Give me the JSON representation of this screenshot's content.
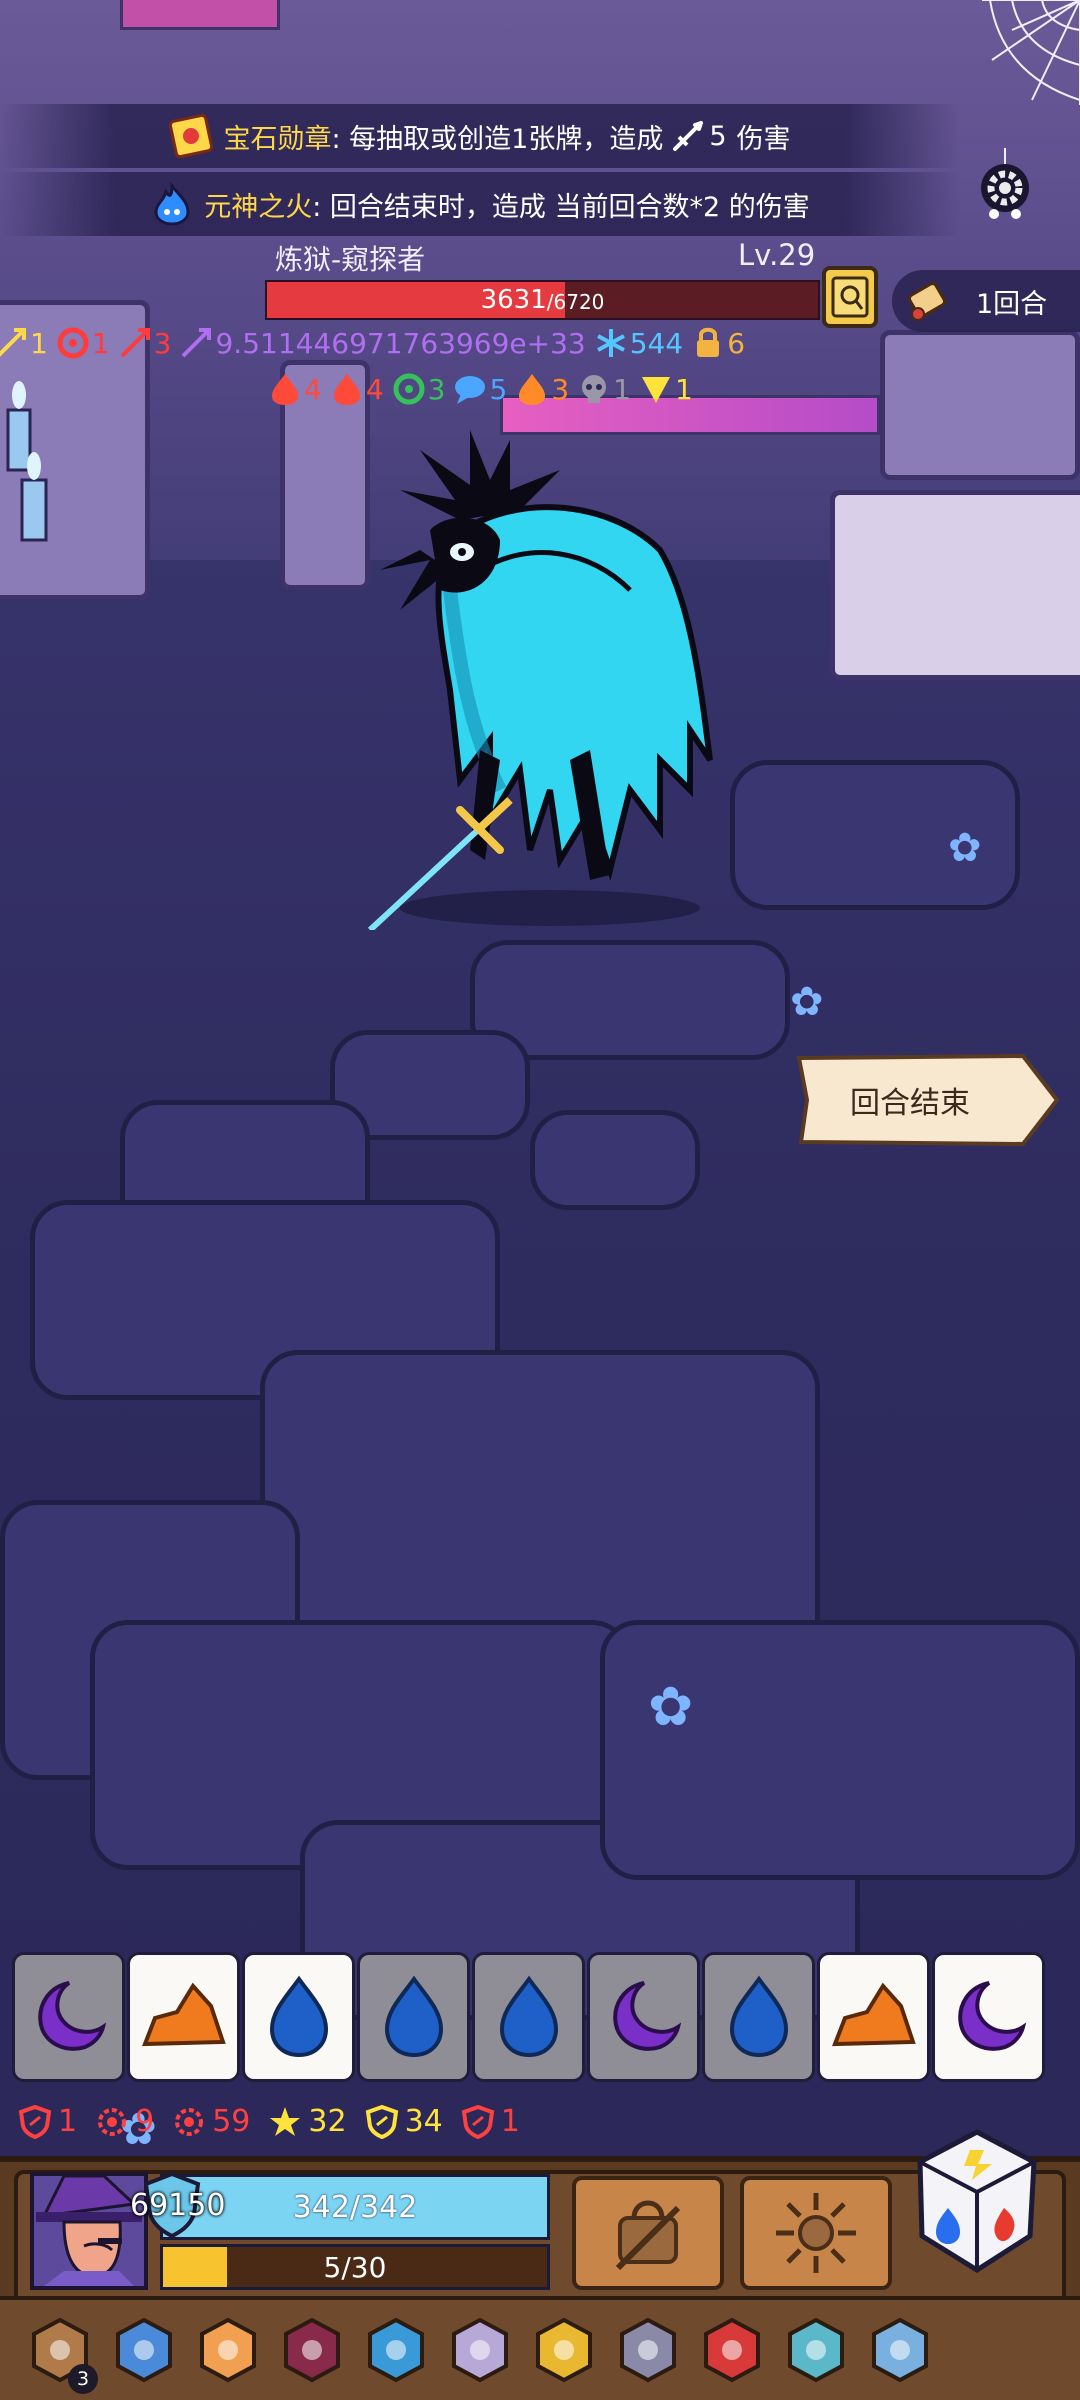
{
  "banners": {
    "gem_medal": {
      "name": "宝石勋章",
      "desc_prefix": ": 每抽取或创造1张牌，造成",
      "damage": "5",
      "desc_suffix": "伤害",
      "icon": "gem-medal-icon"
    },
    "soul_fire": {
      "name": "元神之火",
      "desc": ": 回合结束时，造成 当前回合数*2 的伤害",
      "icon": "blue-fire-icon"
    }
  },
  "enemy": {
    "name": "炼狱-窥探者",
    "level": "Lv.29",
    "hp_current": "3631",
    "hp_max": "/6720",
    "hp_fraction": 0.54
  },
  "round": {
    "label": "1回合"
  },
  "enemy_status": {
    "row1": [
      {
        "icon": "sword-slash-icon",
        "value": "1",
        "color": "#ffd84a"
      },
      {
        "icon": "curl-icon",
        "value": "1",
        "color": "#ff3b3b"
      },
      {
        "icon": "red-wing-icon",
        "value": "3",
        "color": "#ff3b3b"
      },
      {
        "icon": "purple-claw-icon",
        "value": "9.511446971763969e+33",
        "color": "#b06ef0"
      },
      {
        "icon": "snowflake-icon",
        "value": "544",
        "color": "#55c7ff"
      },
      {
        "icon": "lock-icon",
        "value": "6",
        "color": "#f3b340"
      }
    ],
    "row2": [
      {
        "icon": "fire-icon",
        "value": "4",
        "color": "#ff4a3a"
      },
      {
        "icon": "blood-drop-icon",
        "value": "4",
        "color": "#ff4a3a"
      },
      {
        "icon": "poison-icon",
        "value": "3",
        "color": "#36c25a"
      },
      {
        "icon": "speech-icon",
        "value": "5",
        "color": "#4aa6ff"
      },
      {
        "icon": "orange-flame-icon",
        "value": "3",
        "color": "#ff8a2a"
      },
      {
        "icon": "skull-icon",
        "value": "1",
        "color": "#9a97a8"
      },
      {
        "icon": "triangle-icon",
        "value": "1",
        "color": "#ffe23a"
      }
    ]
  },
  "end_turn": {
    "label": "回合结束"
  },
  "hand": [
    {
      "type": "moon",
      "bg": "grey"
    },
    {
      "type": "rock",
      "bg": "white"
    },
    {
      "type": "water",
      "bg": "white"
    },
    {
      "type": "water",
      "bg": "grey"
    },
    {
      "type": "water",
      "bg": "grey"
    },
    {
      "type": "moon",
      "bg": "grey"
    },
    {
      "type": "water",
      "bg": "grey"
    },
    {
      "type": "rock",
      "bg": "white"
    },
    {
      "type": "moon",
      "bg": "white"
    }
  ],
  "player_stats": [
    {
      "icon": "red-shield-sword-icon",
      "value": "1",
      "color": "#ff4040"
    },
    {
      "icon": "red-gear-icon",
      "value": "9",
      "color": "#ff4040"
    },
    {
      "icon": "red-target-icon",
      "value": "59",
      "color": "#ff4040"
    },
    {
      "icon": "yellow-star-icon",
      "value": "32",
      "color": "#ffe23a"
    },
    {
      "icon": "yellow-shield-icon",
      "value": "34",
      "color": "#ffe23a"
    },
    {
      "icon": "red-shield-icon",
      "value": "1",
      "color": "#ff4040"
    }
  ],
  "player": {
    "armor": "69150",
    "hp": "342/342",
    "energy": "5/30",
    "energy_fraction": 0.167
  },
  "relics": [
    {
      "icon": "button-relic-icon",
      "count": "3"
    },
    {
      "icon": "blue-bird-icon"
    },
    {
      "icon": "ring-relic-icon"
    },
    {
      "icon": "purple-cloak-icon"
    },
    {
      "icon": "blue-crystal-icon"
    },
    {
      "icon": "moon-stone-icon"
    },
    {
      "icon": "spellbook-icon"
    },
    {
      "icon": "cube-relic-icon"
    },
    {
      "icon": "red-ring-icon"
    },
    {
      "icon": "blue-feather-icon"
    },
    {
      "icon": "blue-dagger-icon"
    }
  ]
}
